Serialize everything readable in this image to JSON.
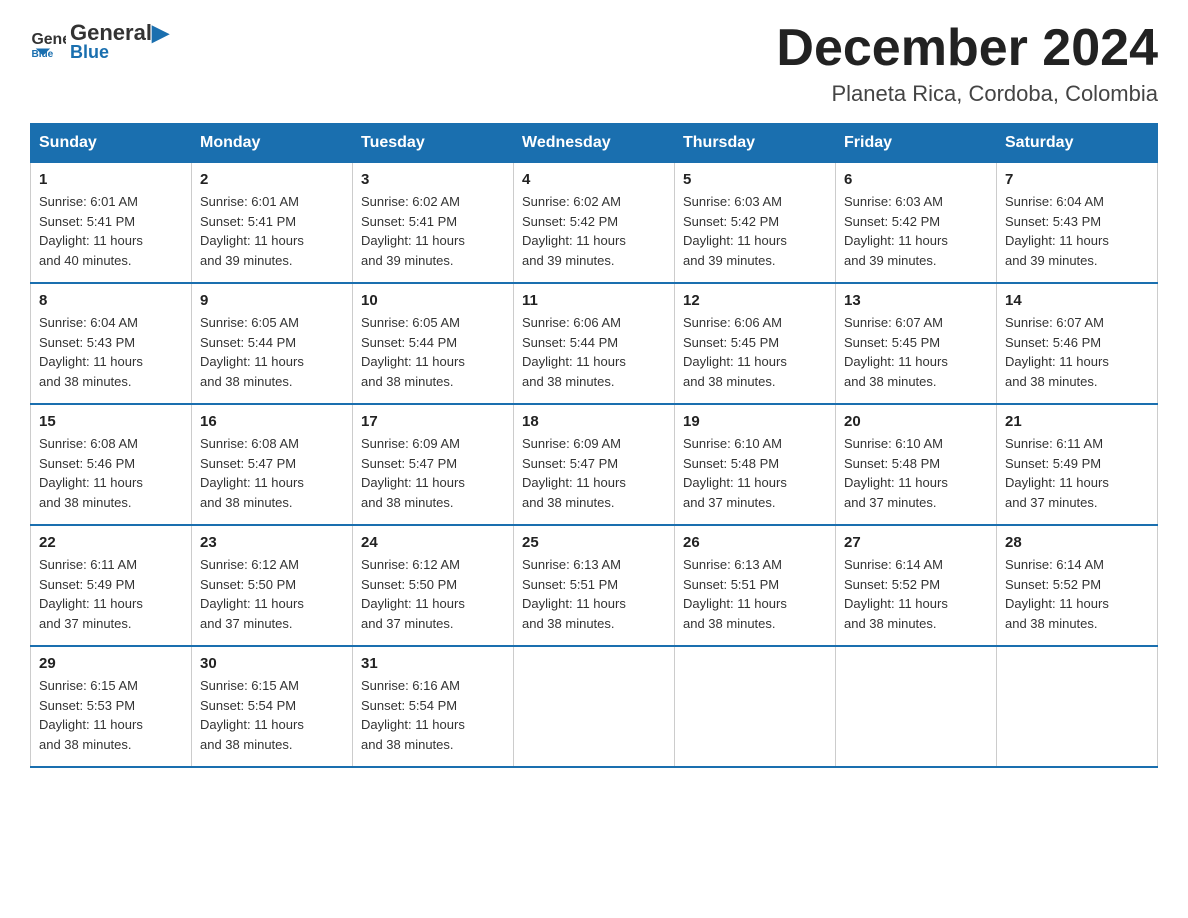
{
  "header": {
    "logo_line1": "General",
    "logo_line2": "Blue",
    "title": "December 2024",
    "subtitle": "Planeta Rica, Cordoba, Colombia"
  },
  "days_of_week": [
    "Sunday",
    "Monday",
    "Tuesday",
    "Wednesday",
    "Thursday",
    "Friday",
    "Saturday"
  ],
  "weeks": [
    [
      {
        "day": "1",
        "sunrise": "6:01 AM",
        "sunset": "5:41 PM",
        "daylight": "11 hours and 40 minutes."
      },
      {
        "day": "2",
        "sunrise": "6:01 AM",
        "sunset": "5:41 PM",
        "daylight": "11 hours and 39 minutes."
      },
      {
        "day": "3",
        "sunrise": "6:02 AM",
        "sunset": "5:41 PM",
        "daylight": "11 hours and 39 minutes."
      },
      {
        "day": "4",
        "sunrise": "6:02 AM",
        "sunset": "5:42 PM",
        "daylight": "11 hours and 39 minutes."
      },
      {
        "day": "5",
        "sunrise": "6:03 AM",
        "sunset": "5:42 PM",
        "daylight": "11 hours and 39 minutes."
      },
      {
        "day": "6",
        "sunrise": "6:03 AM",
        "sunset": "5:42 PM",
        "daylight": "11 hours and 39 minutes."
      },
      {
        "day": "7",
        "sunrise": "6:04 AM",
        "sunset": "5:43 PM",
        "daylight": "11 hours and 39 minutes."
      }
    ],
    [
      {
        "day": "8",
        "sunrise": "6:04 AM",
        "sunset": "5:43 PM",
        "daylight": "11 hours and 38 minutes."
      },
      {
        "day": "9",
        "sunrise": "6:05 AM",
        "sunset": "5:44 PM",
        "daylight": "11 hours and 38 minutes."
      },
      {
        "day": "10",
        "sunrise": "6:05 AM",
        "sunset": "5:44 PM",
        "daylight": "11 hours and 38 minutes."
      },
      {
        "day": "11",
        "sunrise": "6:06 AM",
        "sunset": "5:44 PM",
        "daylight": "11 hours and 38 minutes."
      },
      {
        "day": "12",
        "sunrise": "6:06 AM",
        "sunset": "5:45 PM",
        "daylight": "11 hours and 38 minutes."
      },
      {
        "day": "13",
        "sunrise": "6:07 AM",
        "sunset": "5:45 PM",
        "daylight": "11 hours and 38 minutes."
      },
      {
        "day": "14",
        "sunrise": "6:07 AM",
        "sunset": "5:46 PM",
        "daylight": "11 hours and 38 minutes."
      }
    ],
    [
      {
        "day": "15",
        "sunrise": "6:08 AM",
        "sunset": "5:46 PM",
        "daylight": "11 hours and 38 minutes."
      },
      {
        "day": "16",
        "sunrise": "6:08 AM",
        "sunset": "5:47 PM",
        "daylight": "11 hours and 38 minutes."
      },
      {
        "day": "17",
        "sunrise": "6:09 AM",
        "sunset": "5:47 PM",
        "daylight": "11 hours and 38 minutes."
      },
      {
        "day": "18",
        "sunrise": "6:09 AM",
        "sunset": "5:47 PM",
        "daylight": "11 hours and 38 minutes."
      },
      {
        "day": "19",
        "sunrise": "6:10 AM",
        "sunset": "5:48 PM",
        "daylight": "11 hours and 37 minutes."
      },
      {
        "day": "20",
        "sunrise": "6:10 AM",
        "sunset": "5:48 PM",
        "daylight": "11 hours and 37 minutes."
      },
      {
        "day": "21",
        "sunrise": "6:11 AM",
        "sunset": "5:49 PM",
        "daylight": "11 hours and 37 minutes."
      }
    ],
    [
      {
        "day": "22",
        "sunrise": "6:11 AM",
        "sunset": "5:49 PM",
        "daylight": "11 hours and 37 minutes."
      },
      {
        "day": "23",
        "sunrise": "6:12 AM",
        "sunset": "5:50 PM",
        "daylight": "11 hours and 37 minutes."
      },
      {
        "day": "24",
        "sunrise": "6:12 AM",
        "sunset": "5:50 PM",
        "daylight": "11 hours and 37 minutes."
      },
      {
        "day": "25",
        "sunrise": "6:13 AM",
        "sunset": "5:51 PM",
        "daylight": "11 hours and 38 minutes."
      },
      {
        "day": "26",
        "sunrise": "6:13 AM",
        "sunset": "5:51 PM",
        "daylight": "11 hours and 38 minutes."
      },
      {
        "day": "27",
        "sunrise": "6:14 AM",
        "sunset": "5:52 PM",
        "daylight": "11 hours and 38 minutes."
      },
      {
        "day": "28",
        "sunrise": "6:14 AM",
        "sunset": "5:52 PM",
        "daylight": "11 hours and 38 minutes."
      }
    ],
    [
      {
        "day": "29",
        "sunrise": "6:15 AM",
        "sunset": "5:53 PM",
        "daylight": "11 hours and 38 minutes."
      },
      {
        "day": "30",
        "sunrise": "6:15 AM",
        "sunset": "5:54 PM",
        "daylight": "11 hours and 38 minutes."
      },
      {
        "day": "31",
        "sunrise": "6:16 AM",
        "sunset": "5:54 PM",
        "daylight": "11 hours and 38 minutes."
      },
      null,
      null,
      null,
      null
    ]
  ],
  "labels": {
    "sunrise": "Sunrise:",
    "sunset": "Sunset:",
    "daylight": "Daylight:"
  }
}
